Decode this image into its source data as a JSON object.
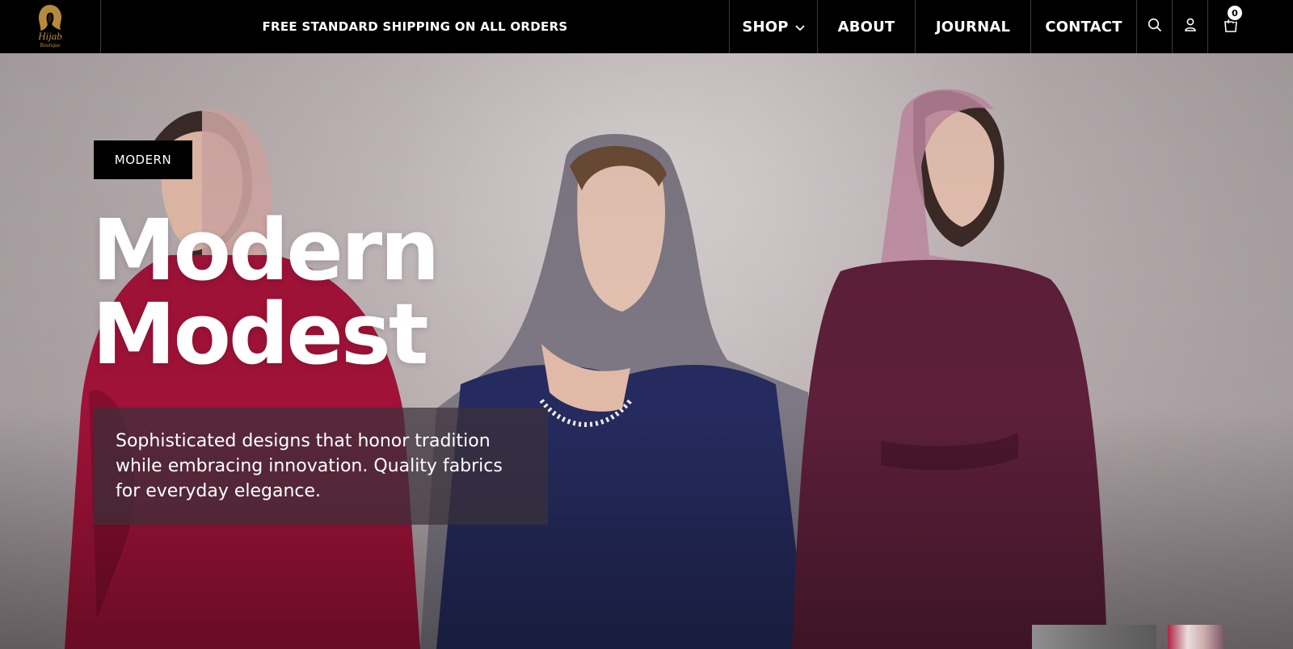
{
  "header": {
    "logo_alt": "Hijab Boutique",
    "logo_text_main": "Hijab",
    "logo_text_sub": "Boutique",
    "promo": "FREE STANDARD SHIPPING ON ALL ORDERS",
    "nav": {
      "shop": "SHOP",
      "about": "ABOUT",
      "journal": "JOURNAL",
      "contact": "CONTACT"
    },
    "icons": {
      "search": "search-icon",
      "account": "user-icon",
      "cart": "cart-icon",
      "shop_dropdown": "chevron-down-icon"
    },
    "cart_count": "0"
  },
  "hero": {
    "tag": "MODERN",
    "title_line1": "Modern",
    "title_line2": "Modest",
    "description": "Sophisticated designs that honor tradition while embracing innovation. Quality fabrics for everyday elegance."
  },
  "colors": {
    "header_bg": "#000000",
    "text_light": "#ffffff",
    "logo_gold": "#b58b3c",
    "desc_box": "#3c303a"
  }
}
